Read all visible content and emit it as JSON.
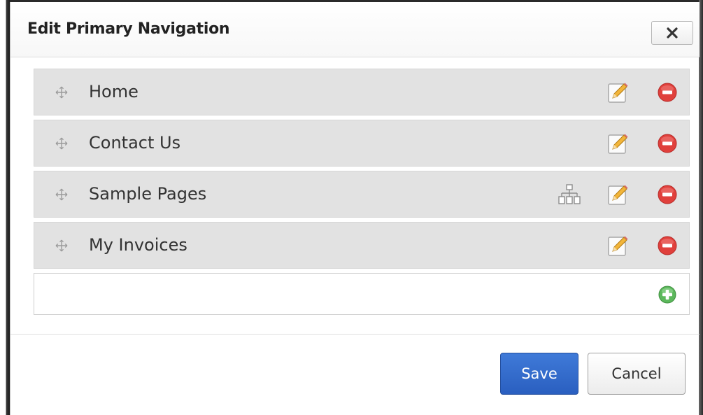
{
  "dialog": {
    "title": "Edit Primary Navigation",
    "close_label": "×"
  },
  "nav": {
    "items": [
      {
        "label": "Home",
        "has_subpages": false,
        "icons": [
          "drag-handle-icon",
          "pencil-edit-icon",
          "minus-circle-icon"
        ]
      },
      {
        "label": "Contact Us",
        "has_subpages": false,
        "icons": [
          "drag-handle-icon",
          "pencil-edit-icon",
          "minus-circle-icon"
        ]
      },
      {
        "label": "Sample Pages",
        "has_subpages": true,
        "icons": [
          "drag-handle-icon",
          "sitemap-icon",
          "pencil-edit-icon",
          "minus-circle-icon"
        ]
      },
      {
        "label": "My Invoices",
        "has_subpages": false,
        "icons": [
          "drag-handle-icon",
          "pencil-edit-icon",
          "minus-circle-icon"
        ]
      }
    ],
    "add_row": {
      "value": "",
      "placeholder": "",
      "icon": "plus-circle-icon"
    }
  },
  "footer": {
    "save_label": "Save",
    "cancel_label": "Cancel"
  },
  "colors": {
    "save_button": "#2f66c9",
    "remove_icon": "#e0403c",
    "add_icon": "#5cb85c",
    "row_background": "#e2e2e2"
  }
}
